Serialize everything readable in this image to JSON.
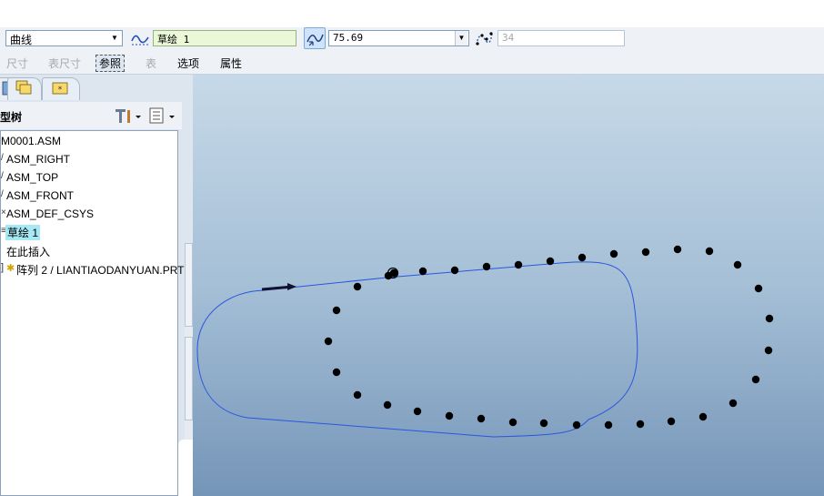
{
  "dashboard": {
    "reference_type": "曲线",
    "sketch_ref": "草绘 1",
    "spacing_value": "75.69",
    "member_count": "34",
    "tabs": [
      {
        "label": "尺寸",
        "state": "disabled"
      },
      {
        "label": "表尺寸",
        "state": "disabled"
      },
      {
        "label": "参照",
        "state": "selected"
      },
      {
        "label": "表",
        "state": "disabled"
      },
      {
        "label": "选项",
        "state": "normal"
      },
      {
        "label": "属性",
        "state": "normal"
      }
    ]
  },
  "model_tree": {
    "title": "型树",
    "items": [
      {
        "label": "M0001.ASM"
      },
      {
        "label": "ASM_RIGHT"
      },
      {
        "label": "ASM_TOP"
      },
      {
        "label": "ASM_FRONT"
      },
      {
        "label": "ASM_DEF_CSYS"
      },
      {
        "label": "草绘 1"
      },
      {
        "label": "在此插入"
      },
      {
        "label": "阵列 2 / LIANTIAODANYUAN.PRT"
      }
    ]
  },
  "colors": {
    "curve": "#2a56e0",
    "points": "#000000",
    "highlight": "#a6e8f4",
    "tree_background": "#ffffff"
  }
}
